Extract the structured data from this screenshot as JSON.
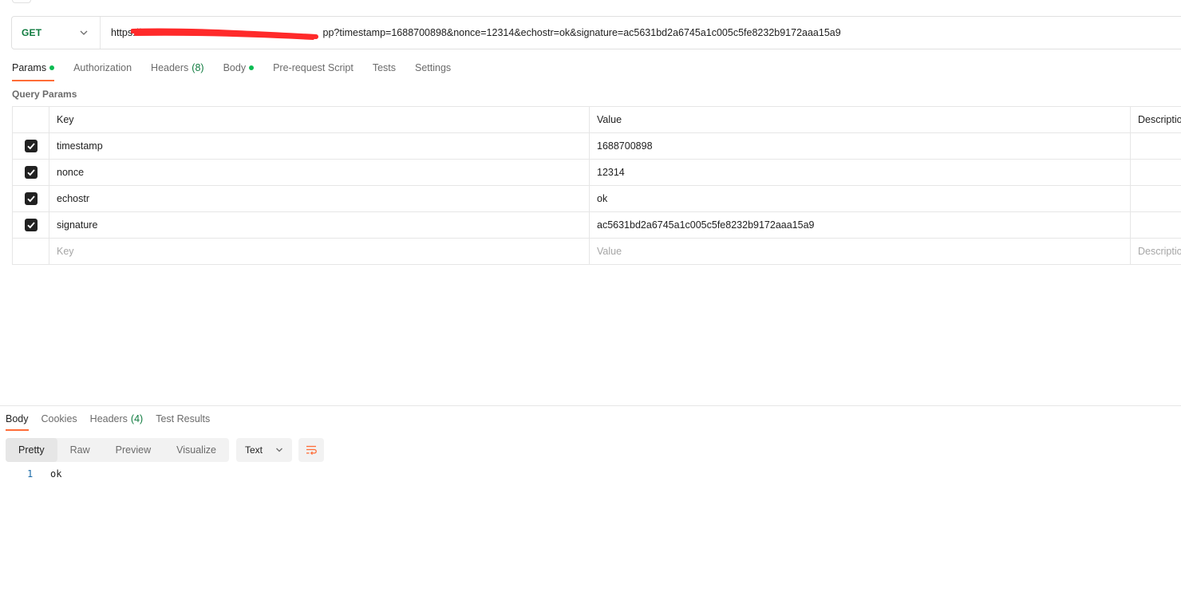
{
  "request": {
    "method": "GET",
    "url": "https://[redacted]pp?timestamp=1688700898&nonce=12314&echostr=ok&signature=ac5631bd2a6745a1c005c5fe8232b9172aaa15a9"
  },
  "request_tabs": [
    {
      "label": "Params",
      "dot": true
    },
    {
      "label": "Authorization"
    },
    {
      "label": "Headers",
      "count": "(8)"
    },
    {
      "label": "Body",
      "dot": true
    },
    {
      "label": "Pre-request Script"
    },
    {
      "label": "Tests"
    },
    {
      "label": "Settings"
    }
  ],
  "query_params": {
    "section_label": "Query Params",
    "headers": {
      "key": "Key",
      "value": "Value",
      "description": "Description"
    },
    "rows": [
      {
        "key": "timestamp",
        "value": "1688700898",
        "checked": true
      },
      {
        "key": "nonce",
        "value": "12314",
        "checked": true
      },
      {
        "key": "echostr",
        "value": "ok",
        "checked": true
      },
      {
        "key": "signature",
        "value": "ac5631bd2a6745a1c005c5fe8232b9172aaa15a9",
        "checked": true
      }
    ],
    "placeholders": {
      "key": "Key",
      "value": "Value",
      "description": "Description"
    }
  },
  "response_tabs": [
    {
      "label": "Body"
    },
    {
      "label": "Cookies"
    },
    {
      "label": "Headers",
      "count": "(4)"
    },
    {
      "label": "Test Results"
    }
  ],
  "view_modes": [
    "Pretty",
    "Raw",
    "Preview",
    "Visualize"
  ],
  "format": "Text",
  "response_body": {
    "line_number": "1",
    "content": "ok"
  },
  "colors": {
    "accent": "#ff6c37",
    "method": "#0f7b3f",
    "dot": "#0cbb52",
    "redaction": "#ff2a2a"
  }
}
